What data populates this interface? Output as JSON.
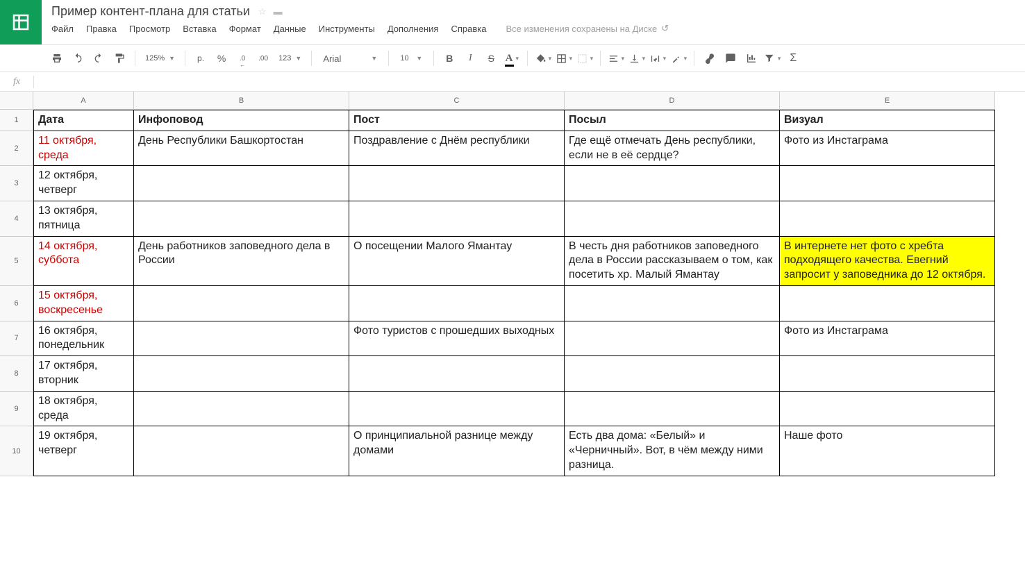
{
  "header": {
    "doc_title": "Пример контент-плана для статьи",
    "save_status": "Все изменения сохранены на Диске"
  },
  "menu": [
    "Файл",
    "Правка",
    "Просмотр",
    "Вставка",
    "Формат",
    "Данные",
    "Инструменты",
    "Дополнения",
    "Справка"
  ],
  "toolbar": {
    "zoom": "125%",
    "currency": "р.",
    "percent": "%",
    "dec_less": ".0",
    "dec_more": ".00",
    "format_123": "123",
    "font_name": "Arial",
    "font_size": "10"
  },
  "columns": [
    "A",
    "B",
    "C",
    "D",
    "E"
  ],
  "row_numbers": [
    "1",
    "2",
    "3",
    "4",
    "5",
    "6",
    "7",
    "8",
    "9",
    "10"
  ],
  "table": {
    "headers": {
      "A": "Дата",
      "B": "Инфоповод",
      "C": "Пост",
      "D": "Посыл",
      "E": "Визуал"
    },
    "rows": [
      {
        "weekend": true,
        "A": "11 октября, среда",
        "B": "День Республики Башкортостан",
        "C": "Поздравление с Днём республики",
        "D": "Где ещё отмечать День республики, если не в её сердце?",
        "E": "Фото из Инстаграма"
      },
      {
        "A": "12 октября, четверг",
        "B": "",
        "C": "",
        "D": "",
        "E": ""
      },
      {
        "A": "13 октября, пятница",
        "B": "",
        "C": "",
        "D": "",
        "E": ""
      },
      {
        "weekend": true,
        "A": "14 октября, суббота",
        "B": "День работников заповедного дела в России",
        "C": "О посещении Малого Ямантау",
        "D": "В честь дня работников заповедного дела в России рассказываем о том, как посетить хр. Малый Ямантау",
        "E": "В интернете нет фото с хребта подходящего качества. Евегний запросит у заповедника до 12 октября.",
        "hlE": true
      },
      {
        "weekend": true,
        "A": "15 октября, воскресенье",
        "B": "",
        "C": "",
        "D": "",
        "E": ""
      },
      {
        "A": "16 октября, понедельник",
        "B": "",
        "C": "Фото туристов с прошедших выходных",
        "D": "",
        "E": "Фото из Инстаграма"
      },
      {
        "A": "17 октября, вторник",
        "B": "",
        "C": "",
        "D": "",
        "E": ""
      },
      {
        "A": "18 октября, среда",
        "B": "",
        "C": "",
        "D": "",
        "E": ""
      },
      {
        "A": "19 октября, четверг",
        "B": "",
        "C": "О принципиальной разнице между домами",
        "D": "Есть два дома: «Белый» и «Черничный». Вот, в чём между ними разница.",
        "E": "Наше фото"
      }
    ]
  }
}
